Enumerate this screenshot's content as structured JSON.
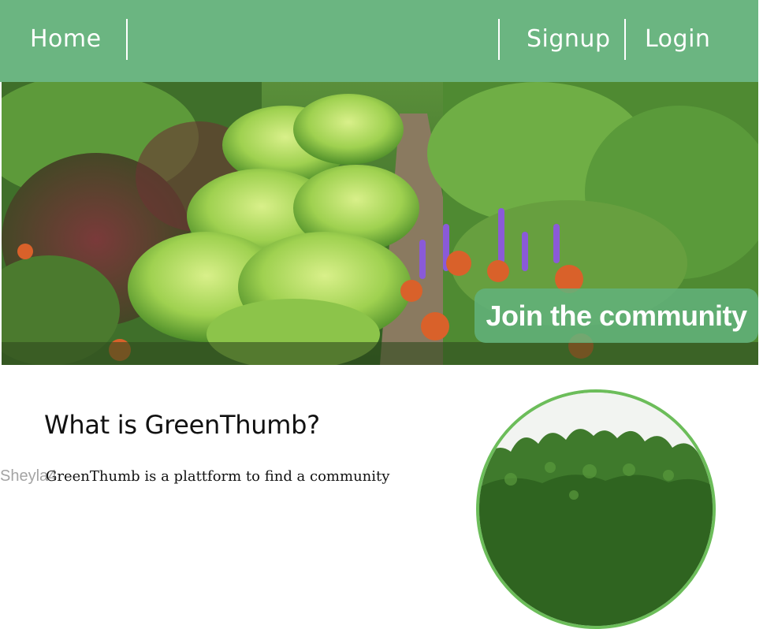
{
  "nav": {
    "home": "Home",
    "signup": "Signup",
    "login": "Login"
  },
  "hero": {
    "cta": "Join the community"
  },
  "about": {
    "title": "What is GreenThumb?",
    "description": "GreenThumb is a plattform to find a community",
    "watermark": "Sheyla4"
  },
  "colors": {
    "nav_background": "#6bb581",
    "cta_background": "#62b27c",
    "circle_border": "#6cbd5a"
  }
}
